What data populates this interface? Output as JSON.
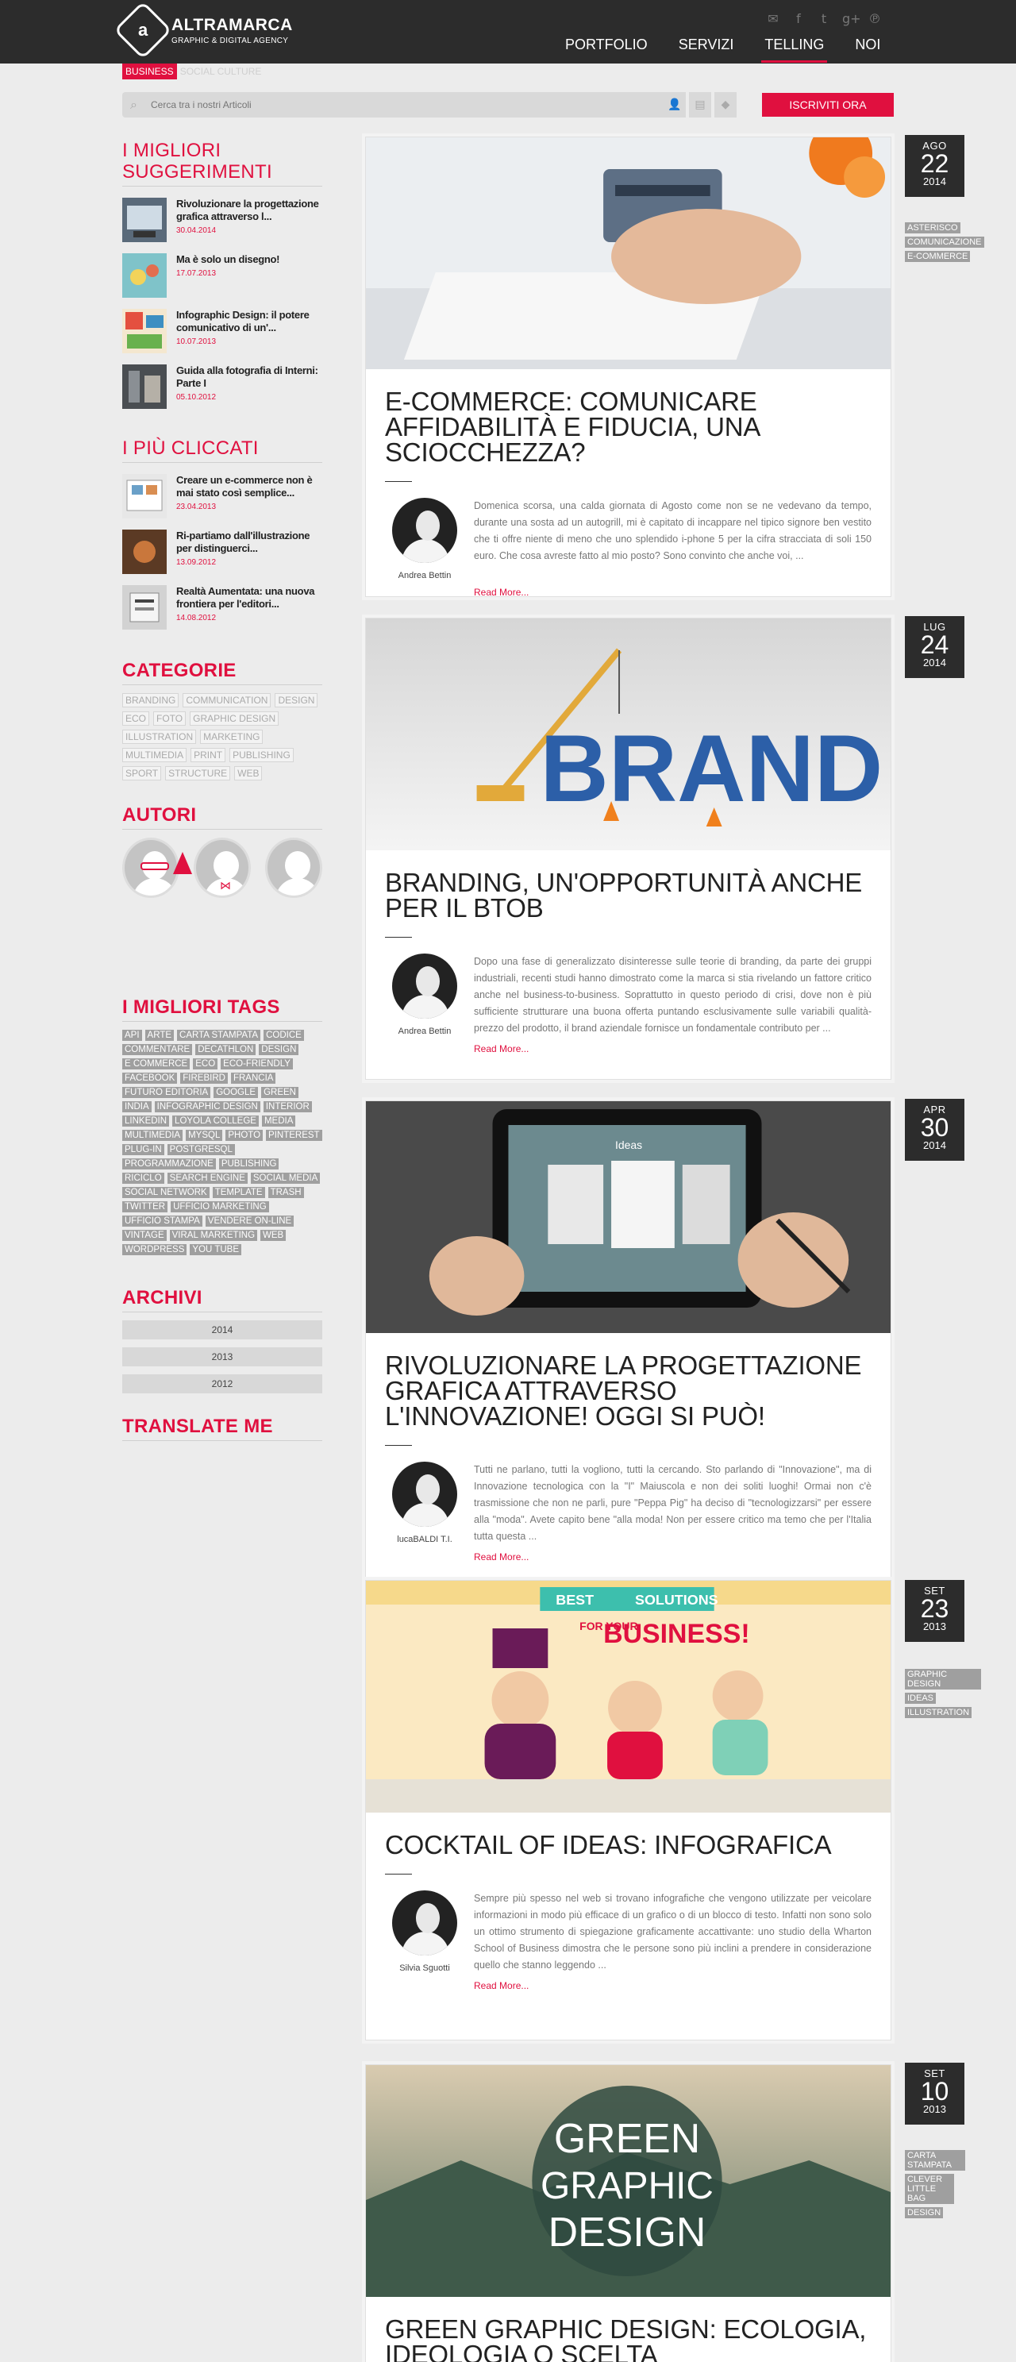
{
  "brand": {
    "name": "ALTRAMARCA",
    "tagline": "GRAPHIC & DIGITAL AGENCY"
  },
  "nav": [
    {
      "label": "PORTFOLIO"
    },
    {
      "label": "SERVIZI"
    },
    {
      "label": "TELLING"
    },
    {
      "label": "NOI"
    }
  ],
  "subnav": {
    "active": "BUSINESS",
    "inactive": "SOCIAL CULTURE"
  },
  "search": {
    "placeholder": "Cerca tra i nostri Articoli"
  },
  "subscribe_label": "ISCRIVITI ORA",
  "sidebar": {
    "best_title": "I MIGLIORI SUGGERIMENTI",
    "best": [
      {
        "title": "Rivoluzionare la progettazione grafica attraverso l...",
        "date": "30.04.2014"
      },
      {
        "title": "Ma è solo un disegno!",
        "date": "17.07.2013"
      },
      {
        "title": "Infographic Design: il potere comunicativo di un'...",
        "date": "10.07.2013"
      },
      {
        "title": "Guida alla fotografia di Interni: Parte I",
        "date": "05.10.2012"
      }
    ],
    "clicked_title": "I PIÙ CLICCATI",
    "clicked": [
      {
        "title": "Creare un e-commerce non è mai stato così semplice...",
        "date": "23.04.2013"
      },
      {
        "title": "Ri-partiamo dall'illustrazione per distinguerci...",
        "date": "13.09.2012"
      },
      {
        "title": "Realtà Aumentata: una nuova frontiera per l'editori...",
        "date": "14.08.2012"
      }
    ],
    "categories_title": "CATEGORIE",
    "categories": [
      "BRANDING",
      "COMMUNICATION",
      "DESIGN",
      "ECO",
      "FOTO",
      "GRAPHIC DESIGN",
      "ILLUSTRATION",
      "MARKETING",
      "MULTIMEDIA",
      "PRINT",
      "PUBLISHING",
      "SPORT",
      "STRUCTURE",
      "WEB"
    ],
    "authors_title": "AUTORI",
    "tags_title": "I MIGLIORI TAGS",
    "tags": [
      "API",
      "ARTE",
      "CARTA STAMPATA",
      "CODICE",
      "COMMENTARE",
      "DECATHLON",
      "DESIGN",
      "E COMMERCE",
      "ECO",
      "ECO-FRIENDLY",
      "FACEBOOK",
      "FIREBIRD",
      "FRANCIA",
      "FUTURO EDITORIA",
      "GOOGLE",
      "GREEN",
      "INDIA",
      "INFOGRAPHIC DESIGN",
      "INTERIOR",
      "LINKEDIN",
      "LOYOLA COLLEGE",
      "MEDIA",
      "MULTIMEDIA",
      "MYSQL",
      "PHOTO",
      "PINTEREST",
      "PLUG-IN",
      "POSTGRESQL",
      "PROGRAMMAZIONE",
      "PUBLISHING",
      "RICICLO",
      "SEARCH ENGINE",
      "SOCIAL MEDIA",
      "SOCIAL NETWORK",
      "TEMPLATE",
      "TRASH",
      "TWITTER",
      "UFFICIO MARKETING",
      "UFFICIO STAMPA",
      "VENDERE ON-LINE",
      "VINTAGE",
      "VIRAL MARKETING",
      "WEB",
      "WORDPRESS",
      "YOU TUBE"
    ],
    "archive_title": "ARCHIVI",
    "archive": [
      "2014",
      "2013",
      "2012"
    ],
    "translate_title": "TRANSLATE ME"
  },
  "posts": [
    {
      "title": "E-COMMERCE: COMUNICARE AFFIDABILITÀ E FIDUCIA, UNA SCIOCCHEZZA?",
      "author": "Andrea Bettin",
      "excerpt": "Domenica scorsa, una calda giornata di Agosto come non se ne vedevano da tempo, durante una sosta ad un autogrill, mi è capitato di incappare nel tipico signore ben vestito che ti offre niente di meno che uno splendido i-phone 5 per la cifra stracciata di soli 150 euro. Che cosa avreste fatto al mio posto? Sono convinto che anche voi, ...",
      "readmore": "Read More...",
      "month": "AGO",
      "day": "22",
      "year": "2014",
      "tags": [
        "ASTERISCO",
        "COMUNICAZIONE",
        "E-COMMERCE"
      ]
    },
    {
      "title": "BRANDING, UN'OPPORTUNITÀ ANCHE PER IL BTOB",
      "author": "Andrea Bettin",
      "excerpt": "Dopo una fase di generalizzato disinteresse sulle teorie di branding, da parte dei gruppi industriali, recenti studi hanno dimostrato come la marca si stia rivelando un fattore critico anche nel business-to-business. Soprattutto in questo periodo di crisi, dove non è più sufficiente strutturare una buona offerta puntando esclusivamente sulle variabili qualità-prezzo del prodotto, il brand aziendale fornisce un fondamentale contributo per ...",
      "readmore": "Read More...",
      "month": "LUG",
      "day": "24",
      "year": "2014",
      "tags": [],
      "image_text": "BRAND"
    },
    {
      "title": "RIVOLUZIONARE LA PROGETTAZIONE GRAFICA ATTRAVERSO L'INNOVAZIONE! OGGI SI PUÒ!",
      "author": "lucaBALDI T.I.",
      "excerpt": "Tutti ne parlano, tutti la vogliono, tutti la cercando. Sto parlando di \"Innovazione\", ma di Innovazione tecnologica con la \"I\" Maiuscola e non dei soliti luoghi! Ormai non c'è trasmissione che non ne parli, pure \"Peppa Pig\" ha deciso di \"tecnologizzarsi\" per essere alla \"moda\". Avete capito bene \"alla moda! Non per essere critico ma temo che per l'Italia tutta questa ...",
      "readmore": "Read More...",
      "month": "APR",
      "day": "30",
      "year": "2014",
      "tags": [],
      "image_text": "Ideas"
    },
    {
      "title": "COCKTAIL OF IDEAS: INFOGRAFICA",
      "author": "Silvia Sguotti",
      "excerpt": "Sempre più spesso nel web si trovano infografiche che vengono utilizzate per veicolare informazioni in modo più efficace di un grafico o di un blocco di testo. Infatti non sono solo un ottimo strumento di spiegazione graficamente accattivante: uno studio della Wharton School of Business dimostra che le persone sono più inclini a prendere in considerazione quello che stanno leggendo ...",
      "readmore": "Read More...",
      "month": "SET",
      "day": "23",
      "year": "2013",
      "tags": [
        "GRAPHIC DESIGN",
        "IDEAS",
        "ILLUSTRATION"
      ],
      "image_text_1": "BEST",
      "image_text_2": "SOLUTIONS",
      "image_text_3": "FOR YOUR",
      "image_text_4": "BUSINESS!"
    },
    {
      "title": "GREEN GRAPHIC DESIGN: ECOLOGIA, IDEOLOGIA O SCELTA",
      "month": "SET",
      "day": "10",
      "year": "2013",
      "tags": [
        "CARTA STAMPATA",
        "CLEVER LITTLE BAG",
        "DESIGN"
      ],
      "image_text_1": "GREEN",
      "image_text_2": "GRAPHIC",
      "image_text_3": "DESIGN"
    }
  ],
  "colors": {
    "accent": "#e0103f",
    "topbar": "#2c2c2c",
    "tag": "#9f9f9f"
  },
  "icons": {
    "social": [
      "mail-icon",
      "facebook-icon",
      "twitter-icon",
      "googleplus-icon",
      "pinterest-icon"
    ],
    "search": "search-icon"
  }
}
